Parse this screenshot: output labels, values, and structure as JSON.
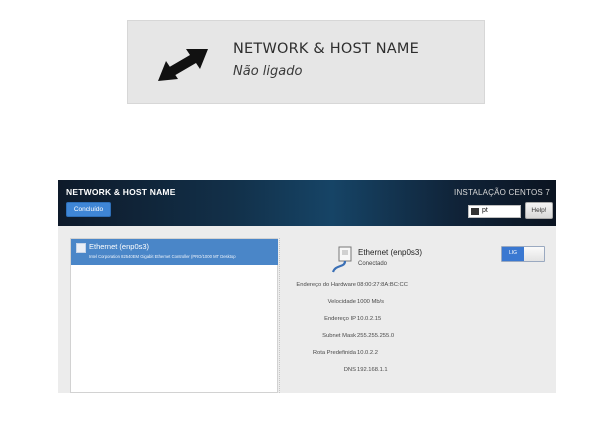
{
  "spoke": {
    "title": "NETWORK & HOST NAME",
    "status": "Não ligado",
    "icon": "network-arrows-icon"
  },
  "header": {
    "title": "NETWORK & HOST NAME",
    "done_label": "Concluído",
    "install_title": "INSTALAÇÃO CENTOS 7",
    "keyboard_layout": "pt",
    "help_label": "Help!"
  },
  "devices": [
    {
      "name": "Ethernet (enp0s3)",
      "description": "Intel Corporation 82540EM Gigabit Ethernet Controller (PRO/1000 MT Desktop"
    }
  ],
  "selected_device": {
    "name": "Ethernet (enp0s3)",
    "status": "Conectado",
    "toggle_label": "LIG",
    "toggle_on": true,
    "details": [
      {
        "label": "Endereço do Hardware",
        "value": "08:00:27:8A:BC:CC"
      },
      {
        "label": "Velocidade",
        "value": "1000 Mb/s"
      },
      {
        "label": "Endereço IP",
        "value": "10.0.2.15"
      },
      {
        "label": "Subnet Mask",
        "value": "255.255.255.0"
      },
      {
        "label": "Rota Predefinida",
        "value": "10.0.2.2"
      },
      {
        "label": "DNS",
        "value": "192.168.1.1"
      }
    ]
  },
  "colors": {
    "accent": "#3f86d6",
    "selection": "#4a86c8",
    "header_dark": "#0e1a2a"
  }
}
